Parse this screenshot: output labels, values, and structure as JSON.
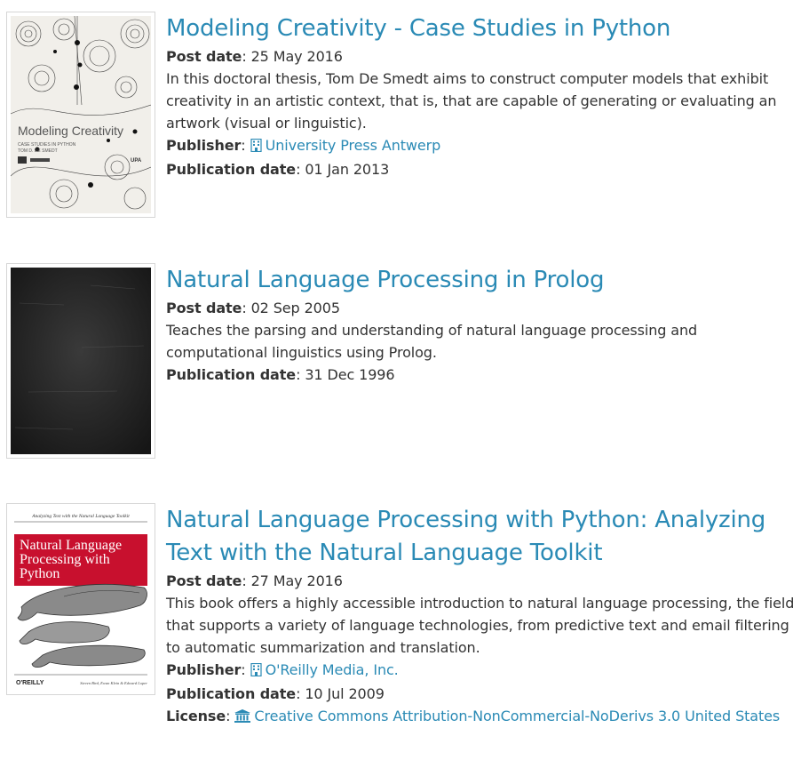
{
  "labels": {
    "post_date": "Post date",
    "publisher": "Publisher",
    "publication_date": "Publication date",
    "license": "License"
  },
  "entries": [
    {
      "title": "Modeling Creativity - Case Studies in Python",
      "post_date": "25 May 2016",
      "description": "In this doctoral thesis, Tom De Smedt aims to construct computer models that exhibit creativity in an artistic context, that is, that are capable of generating or evaluating an artwork (visual or linguistic).",
      "publisher": "University Press Antwerp",
      "publication_date": "01 Jan 2013",
      "cover": {
        "title": "Modeling Creativity",
        "subtitle": "CASE STUDIES IN PYTHON",
        "author": "TOM D. DE SMEDT",
        "badge": "UPA"
      }
    },
    {
      "title": "Natural Language Processing in Prolog",
      "post_date": "02 Sep 2005",
      "description": "Teaches the parsing and understanding of natural language processing and computational linguistics using Prolog.",
      "publication_date": "31 Dec 1996"
    },
    {
      "title": "Natural Language Processing with Python: Analyzing Text with the Natural Language Toolkit",
      "post_date": "27 May 2016",
      "description": "This book offers a highly accessible introduction to natural language processing, the field that supports a variety of language technologies, from predictive text and email filtering to automatic summarization and translation.",
      "publisher": "O'Reilly Media, Inc.",
      "publication_date": "10 Jul 2009",
      "license": "Creative Commons Attribution-NonCommercial-NoDerivs 3.0 United States",
      "cover": {
        "tagline": "Analyzing Text with the Natural Language Toolkit",
        "title_line1": "Natural Language",
        "title_line2": "Processing with",
        "title_line3": "Python",
        "publisher_logo": "O'REILLY",
        "authors": "Steven Bird, Ewan Klein & Edward Loper"
      }
    }
  ],
  "colors": {
    "link": "#2a8ab5",
    "text": "#333333",
    "oreilly_red": "#c8102e"
  },
  "icons": {
    "publisher": "building-icon",
    "license": "institution-icon"
  }
}
